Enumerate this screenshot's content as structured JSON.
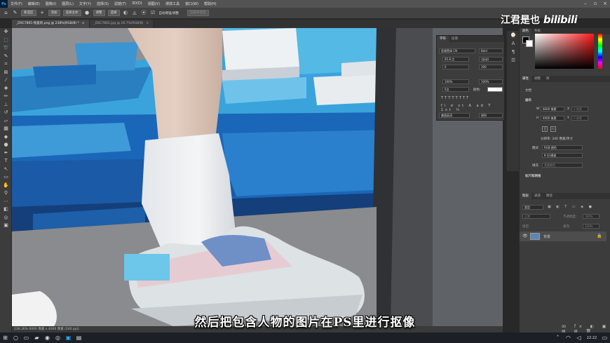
{
  "menubar": {
    "app_logo": "Ps",
    "items": [
      "文件(F)",
      "编辑(E)",
      "图像(I)",
      "图层(L)",
      "文字(Y)",
      "选择(S)",
      "滤镜(T)",
      "3D(D)",
      "视图(V)",
      "增效工具",
      "窗口(W)",
      "帮助(H)"
    ]
  },
  "optionsbar": {
    "mode_value": "新选区",
    "btn_add": "添加",
    "btn_select_subject": "选择主体",
    "btn_refine": "调整",
    "btn_select": "选择",
    "auto_enhance": "自动增强/调整",
    "right_label": "选择并遮住"
  },
  "tabs": [
    {
      "label": "_DSC7865-恢复的.png @ 238%(RGB/8) *",
      "active": true,
      "close": "×"
    },
    {
      "label": "_DSC7862.jpg @ 16.7%(RGB/8)",
      "active": false,
      "close": "×"
    }
  ],
  "statusbar": {
    "text": "238.36%   6000 像素 x 4000 像素 (240 ppi)"
  },
  "subtitle": "然后把包含人物的图片在PS里进行抠像",
  "watermark": {
    "name": "江君是也",
    "brand": "bilibili"
  },
  "character_panel": {
    "tabs": [
      "字符",
      "段落"
    ],
    "font_family": "思源黑体 CN",
    "font_style": "Bold",
    "font_size": "65.8 点",
    "leading": "(自动)",
    "kerning": "0",
    "tracking": "100",
    "vscale": "100%",
    "hscale": "100%",
    "baseline": "0点",
    "color_label": "颜色:",
    "lang": "美国英语",
    "aa": "锐利"
  },
  "right_panels": {
    "color_tabs": [
      "颜色",
      "色板"
    ],
    "props_tabs": [
      "属性",
      "调整",
      "库"
    ],
    "doc_label": "文档",
    "canvas_label": "画布",
    "width_label": "W",
    "width_value": "6000 像素",
    "height_label": "H",
    "height_value": "4000 像素",
    "x_label": "X",
    "x_value": "0 像素",
    "y_label": "Y",
    "y_value": "0 像素",
    "resolution": "分辨率: 240 像素/英寸",
    "mode_label": "模式",
    "mode_value": "RGB 颜色",
    "depth_value": "8 位/通道",
    "fill_label": "填充",
    "fill_value": "背景颜色",
    "rulers_label": "标尺和网格",
    "layers_tabs": [
      "图层",
      "通道",
      "路径"
    ],
    "kind_value": "类型",
    "blend_value": "正常",
    "opacity_label": "不透明度:",
    "opacity_value": "100%",
    "lock_label": "锁定:",
    "fill2_label": "填充:",
    "fill2_value": "100%",
    "layer_name": "背景"
  },
  "taskbar": {
    "time": "22:22"
  },
  "colors": {
    "accent": "#31a8ff",
    "panel": "#3c3c3c",
    "canvas_blue": "#1e74c4"
  }
}
